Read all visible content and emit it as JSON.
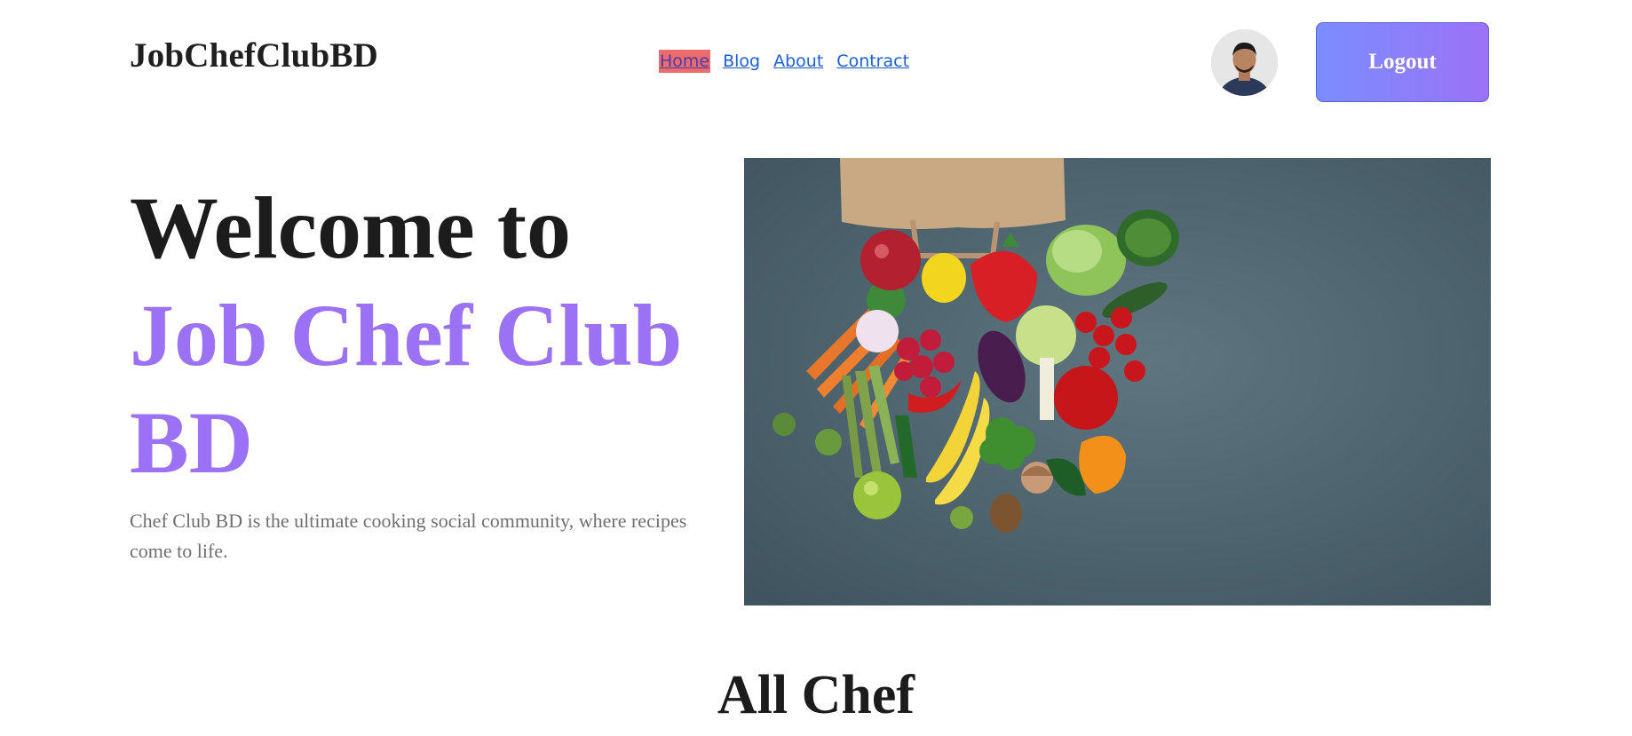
{
  "header": {
    "brand": "JobChefClubBD",
    "nav": [
      {
        "label": "Home",
        "active": true
      },
      {
        "label": "Blog",
        "active": false
      },
      {
        "label": "About",
        "active": false
      },
      {
        "label": "Contract",
        "active": false
      }
    ],
    "logout_label": "Logout",
    "avatar_icon": "user-avatar"
  },
  "hero": {
    "title_line1": "Welcome to",
    "title_accent": "Job Chef Club BD",
    "description": "Chef Club BD is the ultimate cooking social community, where recipes come to life.",
    "image_icon": "vegetables-photo"
  },
  "section": {
    "title": "All Chef"
  },
  "colors": {
    "accent": "#9b72f5",
    "link": "#1d5fd6",
    "active_nav_bg": "#ec6b6b",
    "logout_gradient_start": "#7b8dff",
    "logout_gradient_end": "#9b72f5"
  }
}
